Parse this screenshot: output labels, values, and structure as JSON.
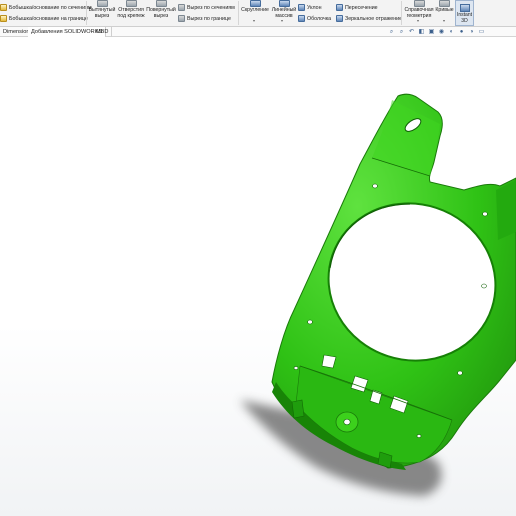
{
  "ribbon": {
    "boss_loft": "Бобышка/основание по сечениям",
    "boss_boundary": "Бобышка/основание на границе",
    "extruded_cut": "Вытянутый вырез",
    "hole_wizard": "Отверстия под крепеж",
    "revolved_cut": "Повернутый вырез",
    "lofted_cut": "Вырез по сечениям",
    "boundary_cut": "Вырез по границе",
    "fillet": "Скругление",
    "linear_pattern": "Линейный массив",
    "draft": "Уклон",
    "shell": "Оболочка",
    "intersect": "Пересечение",
    "mirror": "Зеркальное отражение",
    "reference_geometry": "Справочная геометрия",
    "curves": "Кривые",
    "instant3d": "Instant 3D"
  },
  "tabs": [
    "Dimensions",
    "Добавления SOLIDWORKS",
    "MBD"
  ],
  "view_icons": [
    "search-icon",
    "zoom-area-icon",
    "previous-view-icon",
    "section-view-icon",
    "view-orientation-icon",
    "display-style-icon",
    "hide-show-icon",
    "edit-appearance-icon",
    "scene-icon",
    "view-settings-icon"
  ],
  "colors": {
    "part": "#2fc215",
    "part_dark": "#1f8f0c",
    "part_light": "#5fe23f",
    "background": "#ffffff"
  }
}
